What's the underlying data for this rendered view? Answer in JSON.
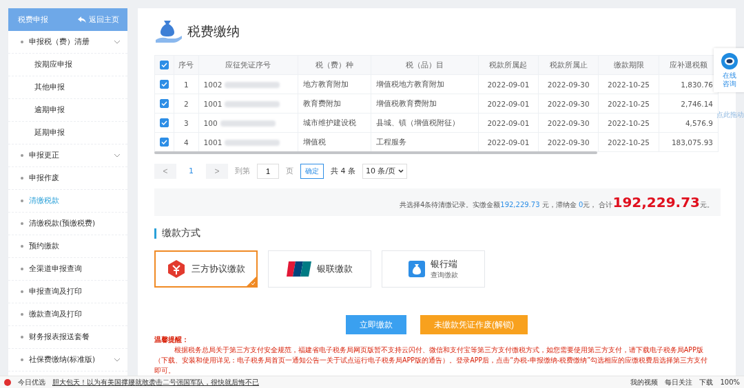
{
  "sidebar": {
    "title": "税费申报",
    "back_link": "返回主页",
    "items": [
      {
        "label": "申报税（费）清册",
        "expandable": true,
        "selected": false,
        "children": [
          {
            "label": "按期应申报",
            "selected": false
          },
          {
            "label": "其他申报",
            "selected": false
          },
          {
            "label": "逾期申报",
            "selected": false
          },
          {
            "label": "延期申报",
            "selected": false
          }
        ]
      },
      {
        "label": "申报更正",
        "expandable": true,
        "selected": false
      },
      {
        "label": "申报作废",
        "expandable": false,
        "selected": false
      },
      {
        "label": "清缴税款",
        "expandable": false,
        "selected": true
      },
      {
        "label": "清缴税款(预缴税费)",
        "expandable": false,
        "selected": false
      },
      {
        "label": "预约缴款",
        "expandable": false,
        "selected": false
      },
      {
        "label": "全渠道申报查询",
        "expandable": false,
        "selected": false
      },
      {
        "label": "申报查询及打印",
        "expandable": false,
        "selected": false
      },
      {
        "label": "缴款查询及打印",
        "expandable": false,
        "selected": false
      },
      {
        "label": "财务报表报送套餐",
        "expandable": false,
        "selected": false
      },
      {
        "label": "社保费缴纳(标准版)",
        "expandable": true,
        "selected": false
      }
    ]
  },
  "page_title": "税费缴纳",
  "table": {
    "all_checked": true,
    "columns": [
      "序号",
      "应征凭证序号",
      "税（费）种",
      "税（品）目",
      "税款所属起",
      "税款所属止",
      "缴款期限",
      "应补退税额"
    ],
    "rows": [
      {
        "checked": true,
        "cells": [
          "1",
          "1002",
          "地方教育附加",
          "增值税地方教育附加",
          "2022-09-01",
          "2022-09-30",
          "2022-10-25",
          "1,830.76"
        ]
      },
      {
        "checked": true,
        "cells": [
          "2",
          "1001",
          "教育费附加",
          "增值税教育费附加",
          "2022-09-01",
          "2022-09-30",
          "2022-10-25",
          "2,746.14"
        ]
      },
      {
        "checked": true,
        "cells": [
          "3",
          "100",
          "城市维护建设税",
          "县城、镇（增值税附征）",
          "2022-09-01",
          "2022-09-30",
          "2022-10-25",
          "4,576.9"
        ]
      },
      {
        "checked": true,
        "cells": [
          "4",
          "1001",
          "增值税",
          "工程服务",
          "2022-09-01",
          "2022-09-30",
          "2022-10-25",
          "183,075.93"
        ]
      }
    ]
  },
  "pagination": {
    "prev": "<",
    "page": "1",
    "next": ">",
    "goto_label": "到第",
    "goto_value": "1",
    "page_unit": "页",
    "confirm": "确定",
    "total": "共 4 条",
    "page_size": "10 条/页"
  },
  "summary": {
    "text": "共选择4条待清缴记录。实缴金额",
    "paid": "192,229.73",
    "paid_unit": "元，滞纳金",
    "late_fee": "0",
    "late_unit": "元， 合计",
    "total": "192,229.73",
    "total_unit": "元。"
  },
  "payment_section": {
    "title": "缴款方式",
    "methods": [
      {
        "kind": "third_party",
        "label": "三方协议缴款",
        "selected": true
      },
      {
        "kind": "unionpay",
        "label": "银联缴款",
        "selected": false
      },
      {
        "kind": "bank",
        "label": "银行端",
        "sublabel": "查询缴款",
        "selected": false
      }
    ]
  },
  "buttons": [
    {
      "kind": "primary",
      "label": "立即缴款"
    },
    {
      "kind": "warning",
      "label": "未缴款凭证作废(解锁)"
    }
  ],
  "notice": {
    "title": "温馨提醒：",
    "body": "根据税务总局关于第三方支付安全规范，福建省电子税务局网页版暂不支持云闪付、微信和支付宝等第三方支付缴税方式，如您需要使用第三方支付，请下载电子税务局APP版（下载、安装和使用详见：电子税务局首页一通知公告一关于试点运行电子税务局APP版的通告）。登录APP后，点击“办税-申报缴纳-税费缴纳”勾选相应的应缴税费后选择第三方支付即可。"
  },
  "chat_widget": {
    "label": "在线咨询",
    "drag_hint": "点此拖动"
  },
  "browser_bar": {
    "left": "今日优选",
    "headline": "胆大包天！以为有美国撑腰就敢袭击二号强国军队，很快就后悔不已",
    "video": "我的视频",
    "follow": "每日关注",
    "download": "下载",
    "zoom": "100%"
  }
}
